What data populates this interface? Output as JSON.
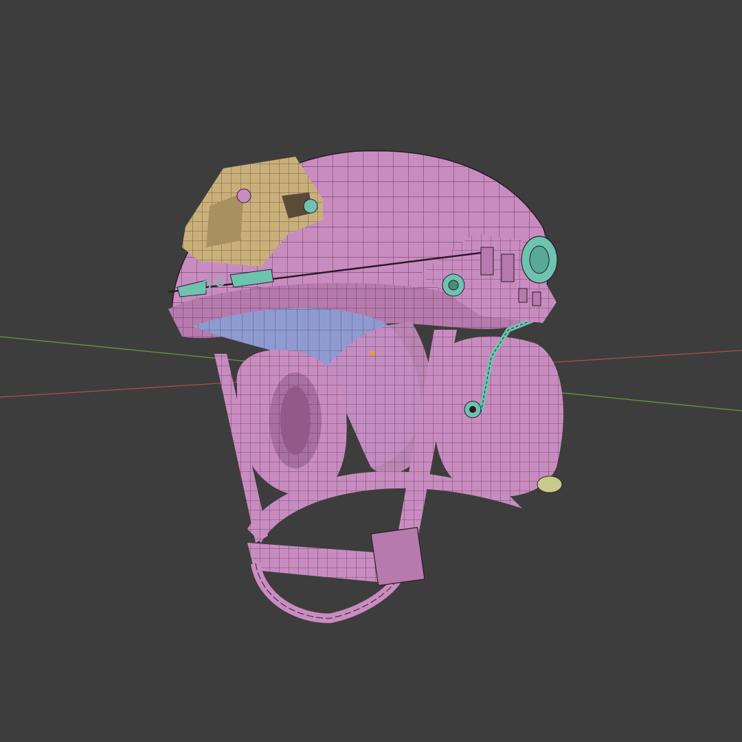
{
  "viewport": {
    "background": "#3d3d3d",
    "x_axis_color": "#b04a4a",
    "y_axis_color": "#6a9a3a",
    "origin_color": "#f0a020"
  },
  "model": {
    "shell_color": "#c98cc0",
    "shell_dark": "#9a5f93",
    "liner_color": "#8f9ad0",
    "mount_color": "#c9b07a",
    "accent_color": "#6ec2b0",
    "wire_color": "#2a1a28",
    "knob_color": "#c9c98a"
  }
}
